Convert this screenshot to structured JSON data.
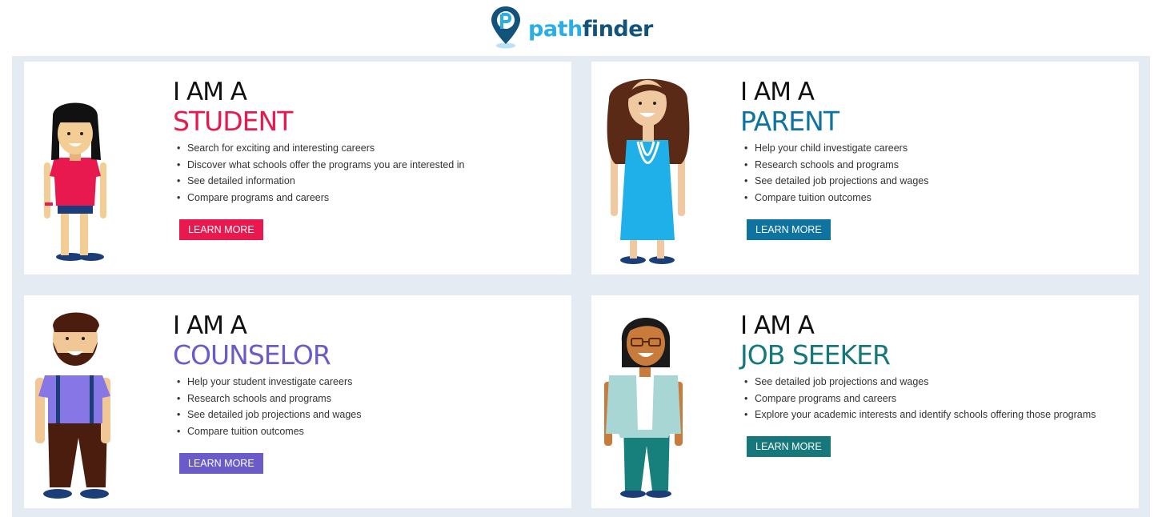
{
  "brand": {
    "part1": "path",
    "part2": "finder",
    "color_light": "#29aee6",
    "color_dark": "#13537a"
  },
  "cards": [
    {
      "prefix": "I AM A",
      "role": "STUDENT",
      "color": "#e8194e",
      "bullets": [
        "Search for exciting and interesting careers",
        "Discover what schools offer the programs you are interested in",
        "See detailed information",
        "Compare programs and careers"
      ],
      "button": "LEARN MORE"
    },
    {
      "prefix": "I AM A",
      "role": "PARENT",
      "color": "#0f73a0",
      "bullets": [
        "Help your child investigate careers",
        "Research schools and programs",
        "See detailed job projections and wages",
        "Compare tuition outcomes"
      ],
      "button": "LEARN MORE"
    },
    {
      "prefix": "I AM A",
      "role": "COUNSELOR",
      "color": "#6a5bc9",
      "bullets": [
        "Help your student investigate careers",
        "Research schools and programs",
        "See detailed job projections and wages",
        "Compare tuition outcomes"
      ],
      "button": "LEARN MORE"
    },
    {
      "prefix": "I AM A",
      "role": "JOB SEEKER",
      "color": "#16787a",
      "bullets": [
        "See detailed job projections and wages",
        "Compare programs and careers",
        "Explore your academic interests and identify schools offering those programs"
      ],
      "button": "LEARN MORE"
    }
  ]
}
